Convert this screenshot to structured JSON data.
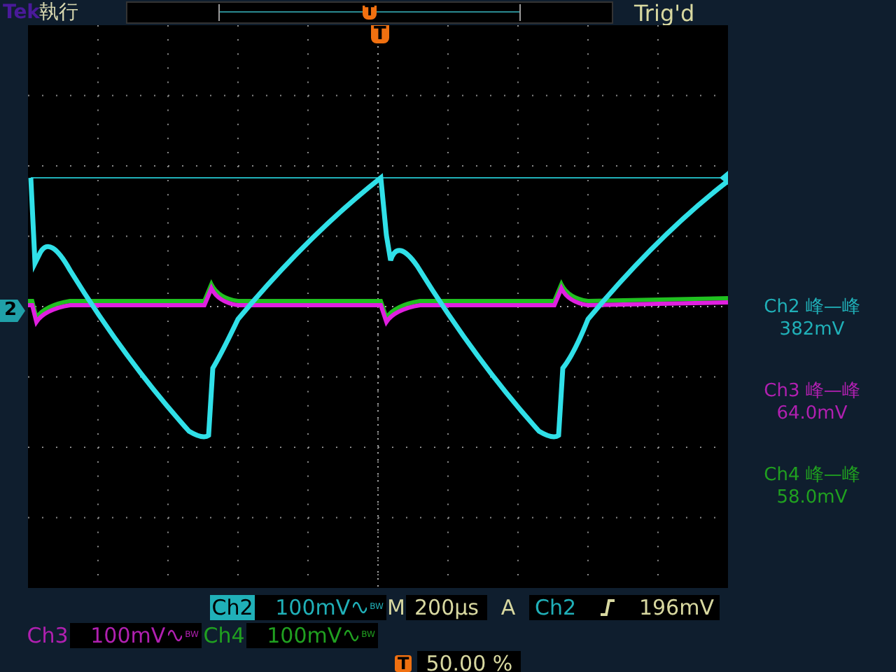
{
  "header": {
    "brand": "Tek",
    "run_state": "執行",
    "record_marker": "T",
    "trigger_status": "Trig'd"
  },
  "display": {
    "trigger_position_marker": "T",
    "channel_marker": "2"
  },
  "measurements": [
    {
      "channel": "Ch2",
      "type": "峰—峰",
      "value": "382mV",
      "color": "#20b0b8"
    },
    {
      "channel": "Ch3",
      "type": "峰—峰",
      "value": "64.0mV",
      "color": "#b020b0"
    },
    {
      "channel": "Ch4",
      "type": "峰—峰",
      "value": "58.0mV",
      "color": "#20a020"
    }
  ],
  "channels": [
    {
      "name": "Ch2",
      "scale": "100mV",
      "bw": "BW",
      "selected": true,
      "color": "#20b0b8"
    },
    {
      "name": "Ch3",
      "scale": "100mV",
      "bw": "BW",
      "selected": false,
      "color": "#b020b0"
    },
    {
      "name": "Ch4",
      "scale": "100mV",
      "bw": "BW",
      "selected": false,
      "color": "#20a020"
    }
  ],
  "timebase": {
    "label": "M",
    "value": "200µs"
  },
  "trigger": {
    "label": "A",
    "source": "Ch2",
    "level": "196mV"
  },
  "horizontal_position": {
    "marker": "T",
    "value": "50.00 %"
  }
}
